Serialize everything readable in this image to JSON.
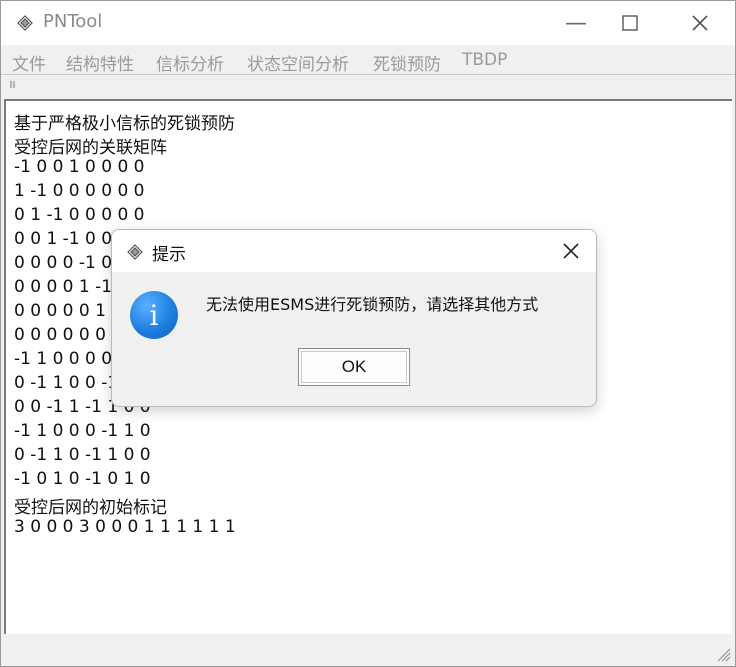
{
  "window": {
    "title": "PNTool"
  },
  "menu": [
    "文件",
    "结构特性",
    "信标分析",
    "状态空间分析",
    "死锁预防",
    "TBDP"
  ],
  "content_lines": [
    "基于严格极小信标的死锁预防",
    "受控后网的关联矩阵",
    "-1 0 0 1 0 0 0 0",
    "1 -1 0 0 0 0 0 0",
    "0 1 -1 0 0 0 0 0",
    "0 0 1 -1 0 0 0 0",
    "0 0 0 0 -1 0 1 0",
    "0 0 0 0 1 -1 0 0",
    "0 0 0 0 0 1 -1 0",
    "0 0 0 0 0 0 1 -1",
    "-1 1 0 0 0 0 0 1",
    "0 -1 1 0 0 -1 1 0",
    "0 0 -1 1 -1 1 0 0",
    "-1 1 0 0 0 -1 1 0",
    "0 -1 1 0 -1 1 0 0",
    "-1 0 1 0 -1 0 1 0",
    "受控后网的初始标记",
    "3 0 0 0 3 0 0 0 1 1 1 1 1 1"
  ],
  "dialog": {
    "title": "提示",
    "message": "无法使用ESMS进行死锁预防，请选择其他方式",
    "ok_label": "OK",
    "icon": "info-icon"
  },
  "icons": {
    "app": "java-coffee-icon",
    "minimize": "minimize-icon",
    "maximize": "maximize-icon",
    "close": "close-icon"
  }
}
